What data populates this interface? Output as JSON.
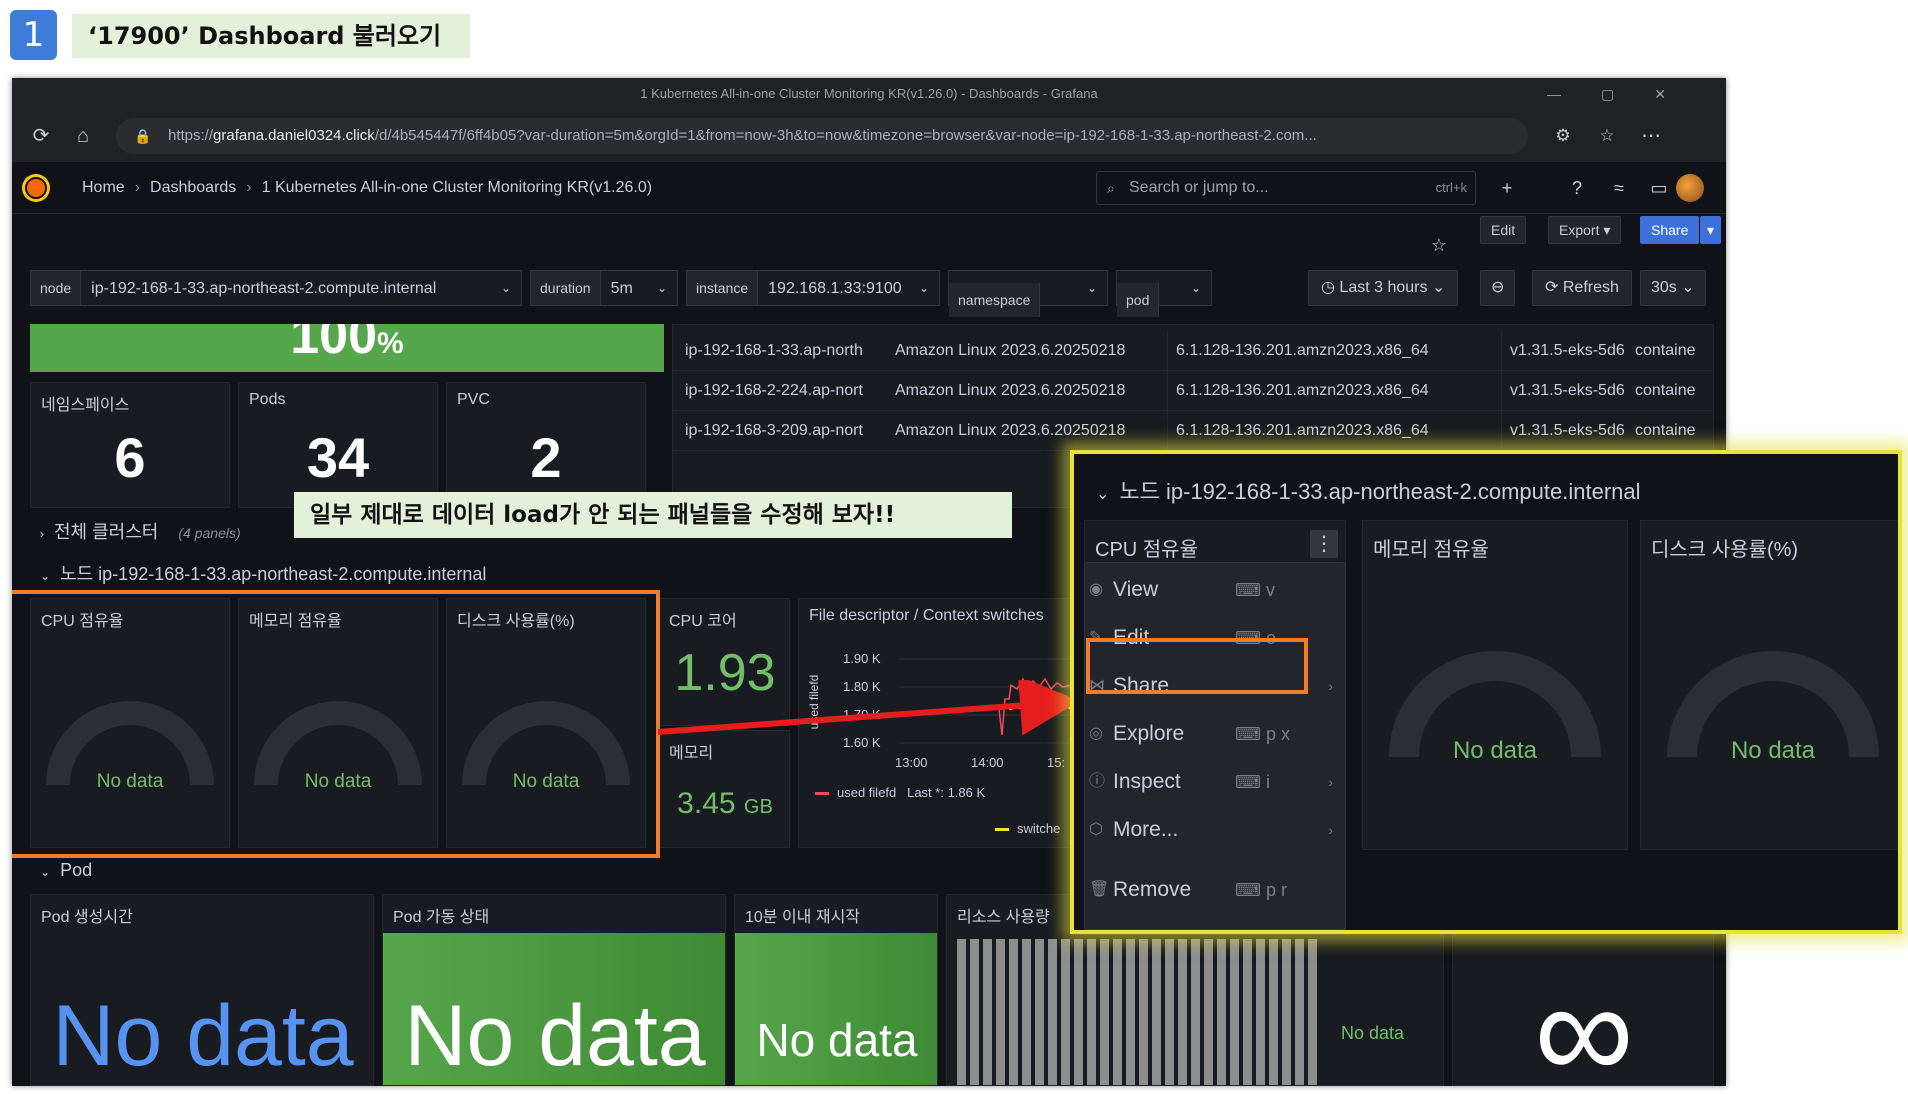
{
  "step": {
    "number": "1",
    "title": "‘17900’ Dashboard 불러오기"
  },
  "browser": {
    "window_title": "1 Kubernetes All-in-one Cluster Monitoring KR(v1.26.0) - Dashboards - Grafana",
    "url_prefix": "https://",
    "url_host": "grafana.daniel0324.click",
    "url_rest": "/d/4b545447f/6ff4b05?var-duration=5m&orgId=1&from=now-3h&to=now&timezone=browser&var-node=ip-192-168-1-33.ap-northeast-2.com..."
  },
  "nav": {
    "breadcrumbs": [
      "Home",
      "Dashboards",
      "1 Kubernetes All-in-one Cluster Monitoring KR(v1.26.0)"
    ],
    "search_placeholder": "Search or jump to...",
    "search_shortcut": "ctrl+k",
    "add_label": "+"
  },
  "actions": {
    "edit": "Edit",
    "export": "Export",
    "share": "Share"
  },
  "variables": [
    {
      "label": "node",
      "value": "ip-192-168-1-33.ap-northeast-2.compute.internal"
    },
    {
      "label": "duration",
      "value": "5m"
    },
    {
      "label": "instance",
      "value": "192.168.1.33:9100"
    },
    {
      "label": "namespace",
      "value": ""
    },
    {
      "label": "pod",
      "value": ""
    }
  ],
  "time": {
    "range": "Last 3 hours",
    "refresh": "Refresh",
    "interval": "30s"
  },
  "top_panels": {
    "percent_value": "100",
    "percent_unit": "%",
    "namespaces": {
      "title": "네임스페이스",
      "value": "6"
    },
    "pods": {
      "title": "Pods",
      "value": "34"
    },
    "pvc": {
      "title": "PVC",
      "value": "2"
    }
  },
  "node_table": [
    {
      "name": "ip-192-168-1-33.ap-north",
      "os": "Amazon Linux 2023.6.20250218",
      "kernel": "6.1.128-136.201.amzn2023.x86_64",
      "kubelet": "v1.31.5-eks-5d6",
      "runtime": "containe"
    },
    {
      "name": "ip-192-168-2-224.ap-nort",
      "os": "Amazon Linux 2023.6.20250218",
      "kernel": "6.1.128-136.201.amzn2023.x86_64",
      "kubelet": "v1.31.5-eks-5d6",
      "runtime": "containe"
    },
    {
      "name": "ip-192-168-3-209.ap-nort",
      "os": "Amazon Linux 2023.6.20250218",
      "kernel": "6.1.128-136.201.amzn2023.x86_64",
      "kubelet": "v1.31.5-eks-5d6",
      "runtime": "containe"
    }
  ],
  "rows": {
    "cluster": {
      "title": "전체 클러스터",
      "count": "(4 panels)"
    },
    "node": {
      "title": "노드 ip-192-168-1-33.ap-northeast-2.compute.internal"
    },
    "pod": {
      "title": "Pod"
    }
  },
  "node_panels": {
    "cpu": {
      "title": "CPU 점유율",
      "value": "No data"
    },
    "memory": {
      "title": "메모리 점유율",
      "value": "No data"
    },
    "disk": {
      "title": "디스크 사용률(%)",
      "value": "No data"
    },
    "cpu_cores": {
      "title": "CPU 코어",
      "value": "1.93"
    },
    "mem_total": {
      "title": "메모리",
      "value": "3.45",
      "unit": "GB"
    },
    "fd": {
      "title": "File descriptor / Context switches",
      "ylabel": "used filefd",
      "y_ticks": [
        "1.90 K",
        "1.80 K",
        "1.70 K",
        "1.60 K"
      ],
      "x_ticks": [
        "13:00",
        "14:00",
        "15:"
      ],
      "legend1": "used filefd   Last *: 1.86 K",
      "legend2": "switche"
    }
  },
  "pod_panels": {
    "created": {
      "title": "Pod 생성시간",
      "value": "No data"
    },
    "status": {
      "title": "Pod 가동 상태",
      "value": "No data"
    },
    "restarts": {
      "title": "10분 이내 재시작",
      "value": "No data"
    },
    "resources": {
      "title": "리소스 사용량",
      "value": "No data"
    },
    "infinity": "∞"
  },
  "callout": "일부 제대로 데이터 load가 안 되는 패널들을 수정해 보자!!",
  "zoom": {
    "row_title": "노드 ip-192-168-1-33.ap-northeast-2.compute.internal",
    "cpu_title": "CPU 점유율",
    "memory_title": "메모리 점유율",
    "disk_title": "디스크 사용률(%)",
    "no_data": "No data",
    "menu": [
      {
        "label": "View",
        "key": "v",
        "submenu": false
      },
      {
        "label": "Edit",
        "key": "e",
        "submenu": false
      },
      {
        "label": "Share",
        "key": "",
        "submenu": true
      },
      {
        "label": "Explore",
        "key": "p x",
        "submenu": false
      },
      {
        "label": "Inspect",
        "key": "i",
        "submenu": true
      },
      {
        "label": "More...",
        "key": "",
        "submenu": true
      },
      {
        "label": "Remove",
        "key": "p r",
        "submenu": false
      }
    ]
  },
  "colors": {
    "accent_green": "#73bf69",
    "highlight_orange": "#ef7d2d",
    "highlight_yellow": "#e8e33a",
    "arrow_red": "#e41e1e",
    "grafana_blue": "#3d71d9",
    "blue_text": "#5794f2"
  }
}
